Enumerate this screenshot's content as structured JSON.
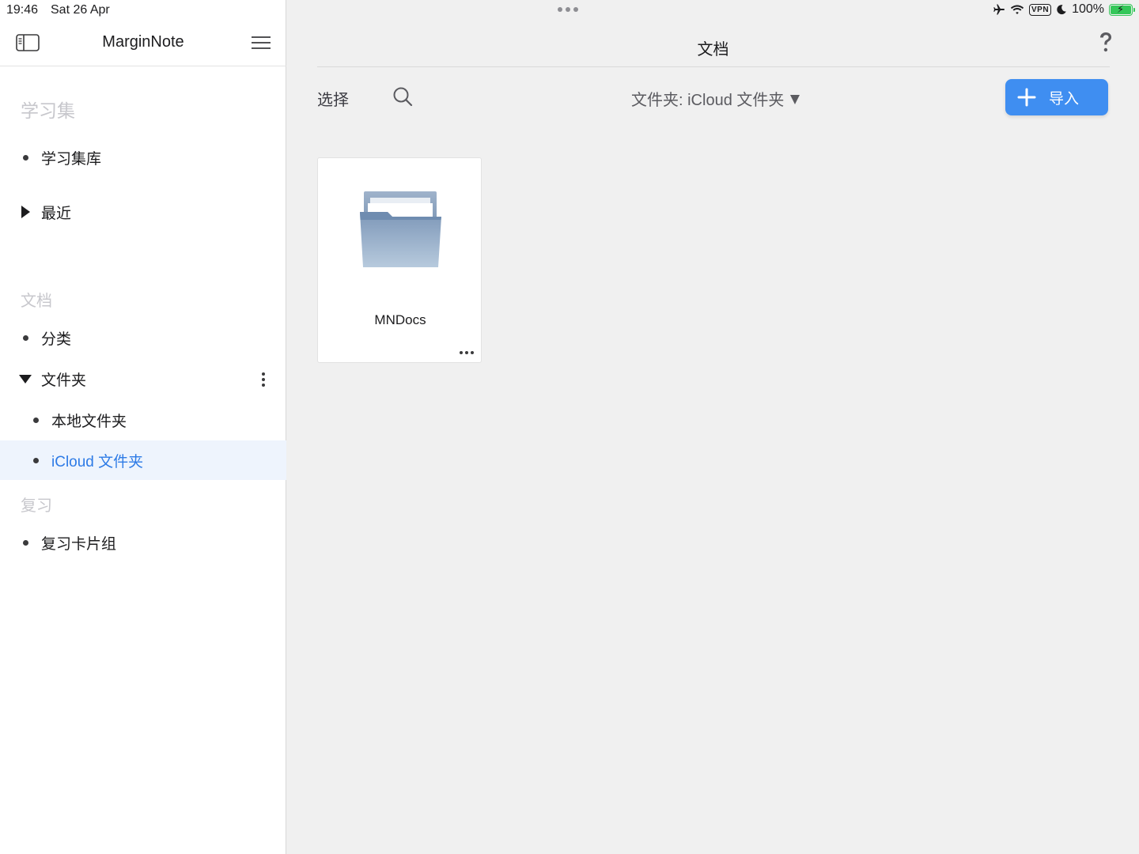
{
  "status_bar": {
    "time": "19:46",
    "date": "Sat 26 Apr",
    "vpn": "VPN",
    "battery": "100%"
  },
  "sidebar": {
    "app_name": "MarginNote",
    "sections": {
      "study_sets": "学习集",
      "documents": "文档",
      "review": "复习"
    },
    "items": {
      "library": "学习集库",
      "recent": "最近",
      "categories": "分类",
      "folders": "文件夹",
      "local_folder": "本地文件夹",
      "icloud_folder": "iCloud 文件夹",
      "review_decks": "复习卡片组"
    },
    "selected": "iCloud 文件夹"
  },
  "main": {
    "title": "文档",
    "toolbar": {
      "select_label": "选择",
      "folder_path": "文件夹: iCloud 文件夹",
      "import_label": "导入"
    },
    "files": [
      {
        "name": "MNDocs",
        "kind": "folder"
      }
    ]
  },
  "colors": {
    "accent": "#3f8ef1",
    "selected_bg": "#eef4fd",
    "selected_text": "#2e7be6",
    "battery": "#34c759"
  }
}
